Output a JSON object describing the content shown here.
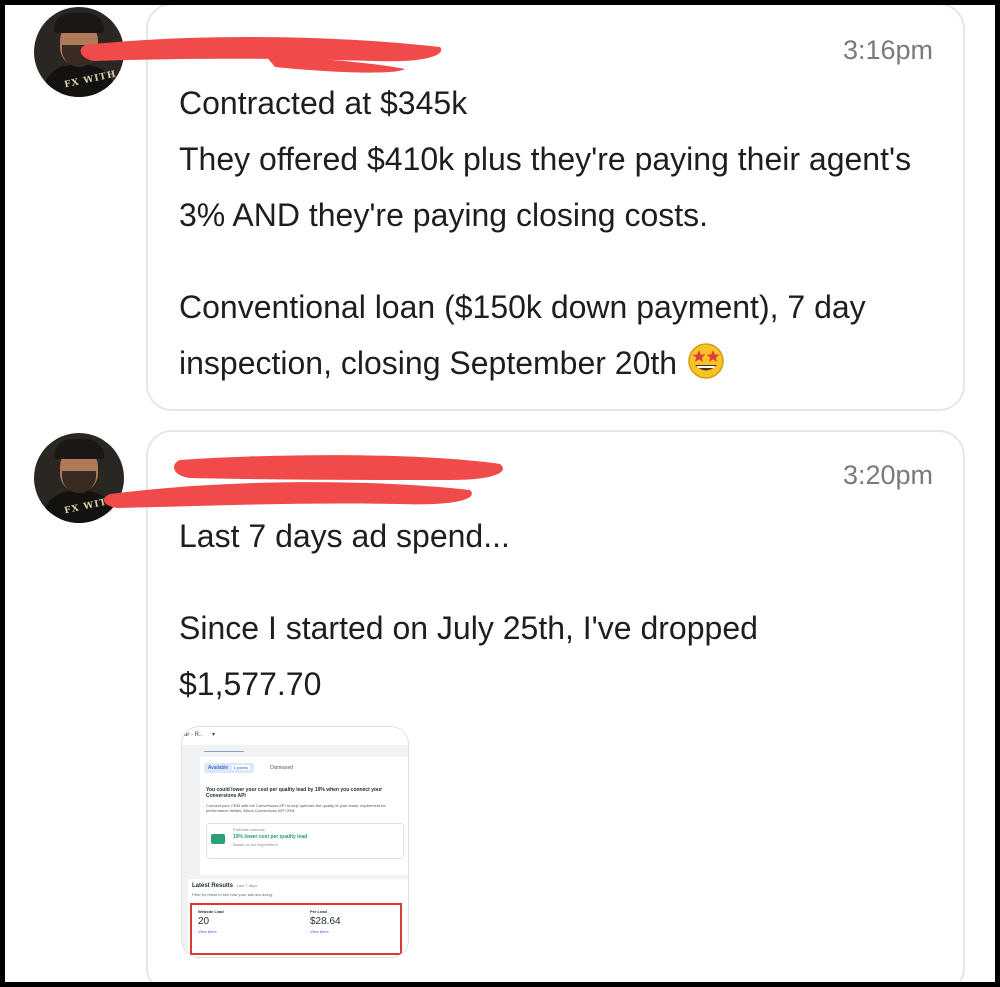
{
  "messages": [
    {
      "time": "3:16pm",
      "lines": [
        "Contracted at $345k",
        "They offered $410k plus they're paying their agent's 3% AND they're paying closing costs.",
        "Conventional loan ($150k down payment), 7 day inspection, closing September 20th"
      ],
      "emoji": "star-struck-emoji"
    },
    {
      "time": "3:20pm",
      "lines": [
        "Last 7 days ad spend...",
        "Since I started on July 25th, I've dropped $1,577.70"
      ],
      "attachment": {
        "dropdown": "ar - R..",
        "tabs": {
          "available": "Available",
          "points": "1 points",
          "dismissed": "Dismissed"
        },
        "rec_title": "You could lower your cost per quality lead by 19% when you connect your Conversions API",
        "rec_body": "Connect your CRM with the Conversions API to help optimize the quality of your leads. experiment for performance details. About Conversions API CRM",
        "outcome_label": "Potential outcome",
        "outcome_value": "19% lower cost per quality lead",
        "outcome_note": "Based on our experiment",
        "results_title": "Latest Results",
        "results_period": "Last 7 days",
        "results_sub": "Filter by result to see how your ads are doing.",
        "metrics": [
          {
            "label": "Website Lead",
            "value": "20",
            "link": "View More"
          },
          {
            "label": "Per Lead",
            "value": "$28.64",
            "link": "View More"
          }
        ]
      }
    }
  ],
  "colors": {
    "redaction": "#f04a4a",
    "highlight_border": "#d93a32",
    "link": "#3b5ee0",
    "outcome_green": "#1f9d72"
  }
}
